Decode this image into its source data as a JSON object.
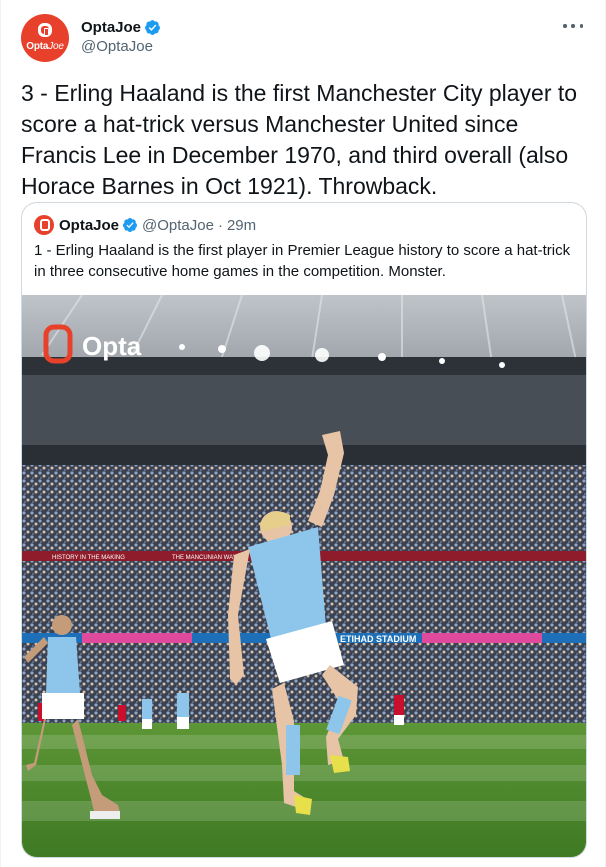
{
  "author": {
    "display_name": "OptaJoe",
    "handle": "@OptaJoe",
    "avatar_text_opta": "Opta",
    "avatar_text_joe": "Joe",
    "verified_icon": "verified-badge-icon"
  },
  "more_icon": "more-dots-icon",
  "tweet": {
    "text": "3 - Erling Haaland is the first Manchester City player to score a hat-trick versus Manchester United since Francis Lee in December 1970, and third overall (also Horace Barnes in Oct 1921). Throwback."
  },
  "quoted_tweet": {
    "display_name": "OptaJoe",
    "handle": "@OptaJoe",
    "dot": "·",
    "time": "29m",
    "text": "1 - Erling Haaland is the first player in Premier League history to score a hat-trick in three consecutive home games in the competition. Monster.",
    "photo": {
      "watermark": "Opta",
      "stadium_banner": "ETIHAD STADIUM",
      "stand_banner_1": "HISTORY IN THE MAKING",
      "stand_banner_2": "THE MANCUNIAN WAY"
    }
  },
  "colors": {
    "accent": "#1d9bf0",
    "brand": "#e8412b",
    "text": "#0f1419",
    "secondary": "#536471",
    "border": "#cfd9de",
    "city_blue": "#8ec5ea",
    "united_red": "#c8102e",
    "pitch": "#4f8a2e"
  }
}
